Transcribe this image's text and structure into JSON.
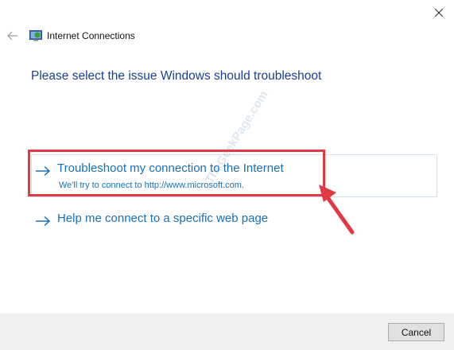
{
  "window": {
    "title": "Internet Connections"
  },
  "main": {
    "heading": "Please select the issue Windows should troubleshoot",
    "options": [
      {
        "title": "Troubleshoot my connection to the Internet",
        "subtitle": "We'll try to connect to http://www.microsoft.com."
      },
      {
        "title": "Help me connect to a specific web page"
      }
    ]
  },
  "watermark": {
    "text": "TheGeekPage.com"
  },
  "footer": {
    "cancel_label": "Cancel"
  },
  "colors": {
    "heading": "#1a3f8f",
    "link": "#1a6fb8",
    "highlight": "#e23a43",
    "footer_bg": "#f0f0f0"
  },
  "icons": {
    "close": "close-icon",
    "back": "back-arrow-icon",
    "app": "network-connections-icon",
    "option": "right-arrow-icon"
  }
}
